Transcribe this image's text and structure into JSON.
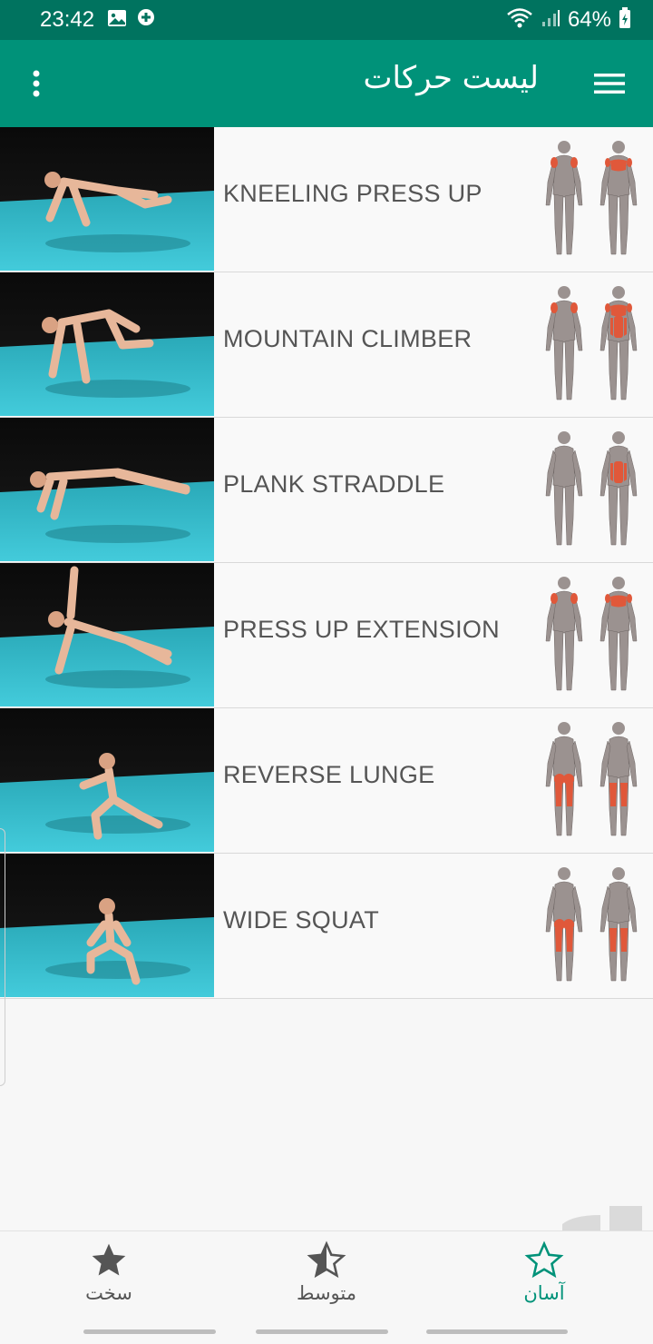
{
  "status_bar": {
    "time": "23:42",
    "battery": "64%",
    "icons": [
      "image-icon",
      "location-icon",
      "wifi-icon",
      "signal-icon",
      "battery-icon"
    ]
  },
  "app_bar": {
    "title": "لیست حرکات",
    "menu_icon": "hamburger-menu-icon",
    "more_icon": "more-vert-icon"
  },
  "exercises": [
    {
      "name": "KNEELING PRESS UP",
      "highlight": "shoulders-chest"
    },
    {
      "name": "MOUNTAIN CLIMBER",
      "highlight": "shoulders-chest-abs"
    },
    {
      "name": "PLANK STRADDLE",
      "highlight": "abs"
    },
    {
      "name": "PRESS UP EXTENSION",
      "highlight": "shoulders-chest"
    },
    {
      "name": "REVERSE LUNGE",
      "highlight": "legs"
    },
    {
      "name": "WIDE SQUAT",
      "highlight": "glutes-thighs"
    }
  ],
  "bottom_nav": {
    "items": [
      {
        "label": "سخت",
        "icon": "star-filled-icon",
        "active": false
      },
      {
        "label": "متوسط",
        "icon": "star-half-icon",
        "active": false
      },
      {
        "label": "آسان",
        "icon": "star-outline-icon",
        "active": true
      }
    ]
  },
  "colors": {
    "status_bar": "#00735f",
    "app_bar": "#009279",
    "accent": "#009279",
    "muscle_highlight": "#e0583a",
    "floor": "#37c4d4"
  }
}
